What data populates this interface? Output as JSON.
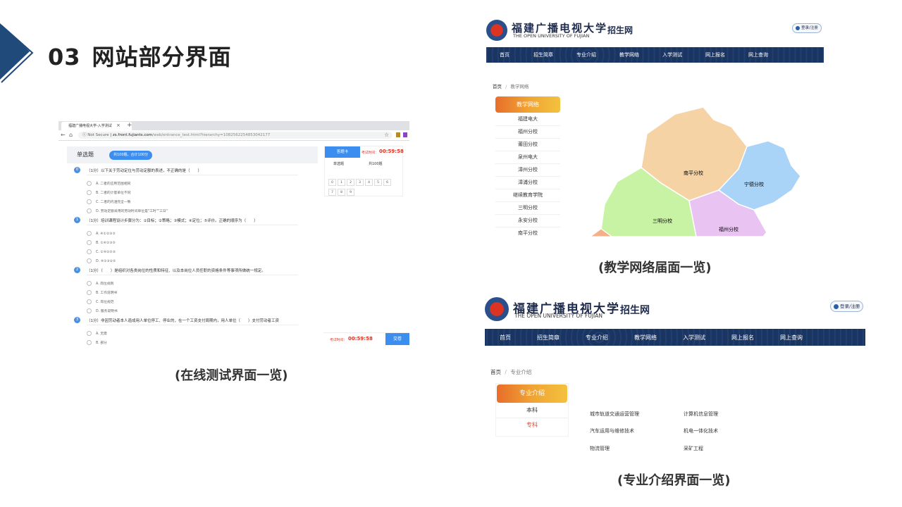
{
  "slide": {
    "number": "03",
    "title": "网站部分界面"
  },
  "captions": {
    "test": "(在线测试界面一览)",
    "network": "(教学网络届面一览)",
    "major": "(专业介绍界面一览)"
  },
  "shot_test": {
    "tab_title": "福建广播电视大学-入学测试",
    "tab_close": "×",
    "tab_new": "+",
    "url_prefix": "Not Secure",
    "url_host": "zs.front.fujiants.com",
    "url_path": "/web/entrance_test.html?hierarchy=1082562254853042177",
    "section": "单选题",
    "summary": "共100题，合计100分",
    "questions": [
      {
        "num": "0",
        "text": "（1分）以下关于劳动定位与劳动定额的表述，不正确的是（　　）",
        "options": [
          "A. 二者的应用范围相同",
          "B. 二者的计量单位不同",
          "C. 二者的内涵完全一致",
          "D. 劳动定额采用的劳动时间单位是\"工时\"\"工日\""
        ]
      },
      {
        "num": "1",
        "text": "（1分）培训课程设计步骤分为：①目标；②策略；③模式；④定位；⑤评价。正确的顺序为（　　）",
        "options": [
          "A. ④①②③⑤",
          "B. ①④②③⑤",
          "C. ①④②⑤③",
          "D. ④①③②⑤"
        ]
      },
      {
        "num": "2",
        "text": "（1分）（　　）是组织对各类岗位的性质和特征、以及本岗位人员任职的资格条件等事项所做统一规定。",
        "options": [
          "A. 岗位规则",
          "B. 工作说明书",
          "C. 岗位规范",
          "D. 服务说明书"
        ]
      },
      {
        "num": "3",
        "text": "（1分）非因劳动者本人造成用人单位停工、停业的，在一个工资支付周期内，用人单位（　　）支付劳动者工资",
        "options": [
          "A. 无需",
          "B. 部分"
        ]
      }
    ],
    "answer_card": {
      "title": "答题卡",
      "time_label": "考试时间：",
      "time": "00:59:58",
      "sub_left": "单选题",
      "sub_right": "共100题",
      "cells": [
        "0",
        "1",
        "2",
        "3",
        "4",
        "5",
        "6",
        "7",
        "8",
        "9"
      ]
    },
    "footer": {
      "time_label": "考试时间：",
      "time": "00:59:58",
      "submit": "交卷"
    }
  },
  "site": {
    "logo_cn": "福建广播电视大学",
    "logo_en": "THE OPEN UNIVERSITY OF FUJIAN",
    "logo_suffix": "招生网",
    "login": "登录/注册",
    "nav": [
      "首页",
      "招生简章",
      "专业介绍",
      "教学网络",
      "入学测试",
      "网上报名",
      "网上查询"
    ]
  },
  "shot_network": {
    "breadcrumb_home": "首页",
    "breadcrumb_sep": "/",
    "breadcrumb_current": "教学网络",
    "sidebar_title": "教学网络",
    "sidebar_items": [
      "福建电大",
      "福州分校",
      "莆田分校",
      "泉州电大",
      "漳州分校",
      "漳浦分校",
      "继续教育学院",
      "三明分校",
      "永安分校",
      "南平分校"
    ],
    "map_labels": {
      "nanping": "南平分校",
      "ningde": "宁德分校",
      "sanming": "三明分校",
      "fuzhou": "福州分校"
    },
    "map_colors": {
      "nanping": "#f6d3a5",
      "ningde": "#a9d3f7",
      "sanming": "#c8f3a5",
      "fuzhou": "#e9c3f2",
      "longyan": "#f5b08a"
    }
  },
  "shot_major": {
    "breadcrumb_home": "首页",
    "breadcrumb_sep": "/",
    "breadcrumb_current": "专业介绍",
    "sidebar_title": "专业介绍",
    "levels": [
      "本科",
      "专科"
    ],
    "active_level": "专科",
    "majors": [
      "城市轨道交通运营管理",
      "计算机信息管理",
      "汽车运用与维修技术",
      "机电一体化技术",
      "物流管理",
      "采矿工程"
    ]
  },
  "colors": {
    "accent_blue": "#3b8ef0",
    "navy": "#1b3563",
    "orange": "#f0a334",
    "deco": "#1f4a7a"
  }
}
